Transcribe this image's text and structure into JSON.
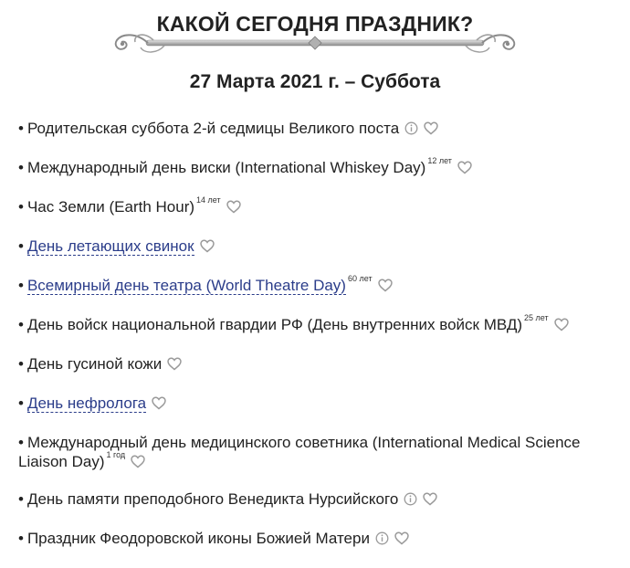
{
  "header": {
    "title": "КАКОЙ СЕГОДНЯ ПРАЗДНИК?",
    "date": "27 Марта 2021 г. – Суббота"
  },
  "colors": {
    "link": "#2b3d8a",
    "text": "#222222",
    "icon": "#9a9a9a"
  },
  "holidays": [
    {
      "text": "Родительская суббота 2-й седмицы Великого поста",
      "years": "",
      "link": false,
      "info": true
    },
    {
      "text": "Международный день виски (International Whiskey Day)",
      "years": "12 лет",
      "link": false,
      "info": false
    },
    {
      "text": "Час Земли (Earth Hour)",
      "years": "14 лет",
      "link": false,
      "info": false
    },
    {
      "text": "День летающих свинок",
      "years": "",
      "link": true,
      "info": false
    },
    {
      "text": "Всемирный день театра (World Theatre Day)",
      "years": "60 лет",
      "link": true,
      "info": false
    },
    {
      "text": "День войск национальной гвардии РФ (День внутренних войск МВД)",
      "years": "25 лет",
      "link": false,
      "info": false
    },
    {
      "text": "День гусиной кожи",
      "years": "",
      "link": false,
      "info": false
    },
    {
      "text": "День нефролога",
      "years": "",
      "link": true,
      "info": false
    },
    {
      "text": "Международный день медицинского советника (International Medical Science Liaison Day)",
      "years": "1 год",
      "link": false,
      "info": false
    },
    {
      "text": "День памяти преподобного Венедикта Нурсийского",
      "years": "",
      "link": false,
      "info": true
    },
    {
      "text": "Праздник Феодоровской иконы Божией Матери",
      "years": "",
      "link": false,
      "info": true
    }
  ]
}
